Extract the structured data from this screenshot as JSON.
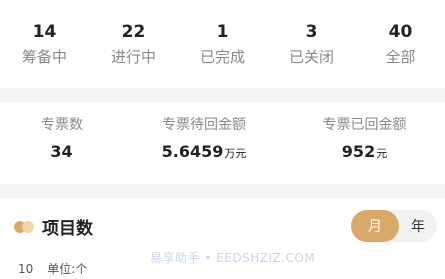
{
  "status_counts": [
    {
      "count": "14",
      "label": "筹备中"
    },
    {
      "count": "22",
      "label": "进行中"
    },
    {
      "count": "1",
      "label": "已完成"
    },
    {
      "count": "3",
      "label": "已关闭"
    },
    {
      "count": "40",
      "label": "全部"
    }
  ],
  "invoices": [
    {
      "label": "专票数",
      "value": "34",
      "unit": ""
    },
    {
      "label": "专票待回金额",
      "value": "5.6459",
      "unit": "万元"
    },
    {
      "label": "专票已回金额",
      "value": "952",
      "unit": "元"
    }
  ],
  "project_chart": {
    "title": "项目数",
    "toggle": {
      "month": "月",
      "year": "年",
      "selected": "month"
    },
    "axis_tick": "10",
    "unit_label": "单位:个",
    "watermark": "易享助手 • EEDSHZIZ.COM"
  },
  "colors": {
    "accent": "#d9a968",
    "accent_light": "#f1d3a6",
    "background": "#f4f5f7",
    "muted_text": "#8a8a8a"
  }
}
